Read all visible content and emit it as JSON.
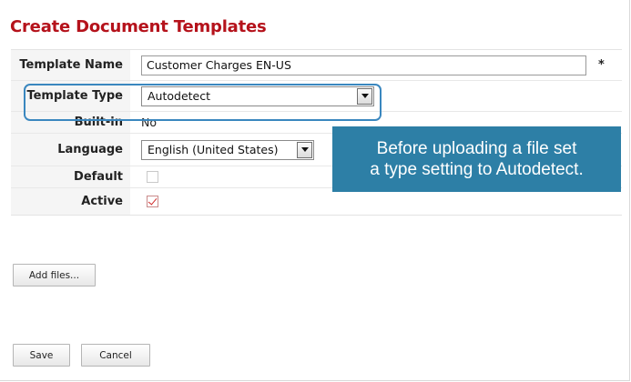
{
  "page": {
    "title": "Create Document Templates"
  },
  "form": {
    "template_name": {
      "label": "Template Name",
      "value": "Customer Charges EN-US",
      "required_marker": "*"
    },
    "template_type": {
      "label": "Template Type",
      "selected": "Autodetect"
    },
    "built_in": {
      "label": "Built-in",
      "value": "No"
    },
    "language": {
      "label": "Language",
      "selected": "English (United States)"
    },
    "default": {
      "label": "Default",
      "checked": false
    },
    "active": {
      "label": "Active",
      "checked": true
    }
  },
  "callout": {
    "line1": "Before uploading a file set",
    "line2": "a type setting to Autodetect.",
    "color": "#2d7fa6"
  },
  "buttons": {
    "add_files": "Add files...",
    "save": "Save",
    "cancel": "Cancel"
  },
  "colors": {
    "title": "#b5121b",
    "highlight_border": "#3a87bf",
    "check_mark": "#d12a2a"
  },
  "icons": {
    "dropdown": "chevron-down-icon",
    "checkmark": "check-icon"
  }
}
